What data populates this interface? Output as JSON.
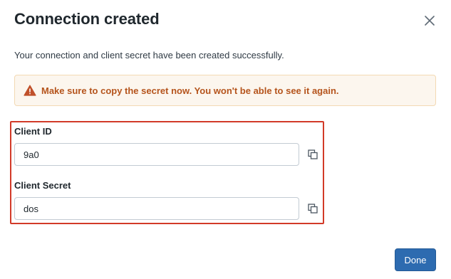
{
  "dialog": {
    "title": "Connection created",
    "close_icon": "close-icon",
    "description": "Your connection and client secret have been created successfully.",
    "alert": {
      "icon": "warning-icon",
      "text": "Make sure to copy the secret now. You won't be able to see it again.",
      "color": "#b5541c",
      "background": "#fcf6ee"
    },
    "client_id": {
      "label": "Client ID",
      "value": "9a0",
      "copy_icon": "copy-icon"
    },
    "client_secret": {
      "label": "Client Secret",
      "value": "dos",
      "copy_icon": "copy-icon"
    },
    "done_label": "Done",
    "accent_color": "#2d6bb0",
    "highlight_color": "#d23a28"
  }
}
